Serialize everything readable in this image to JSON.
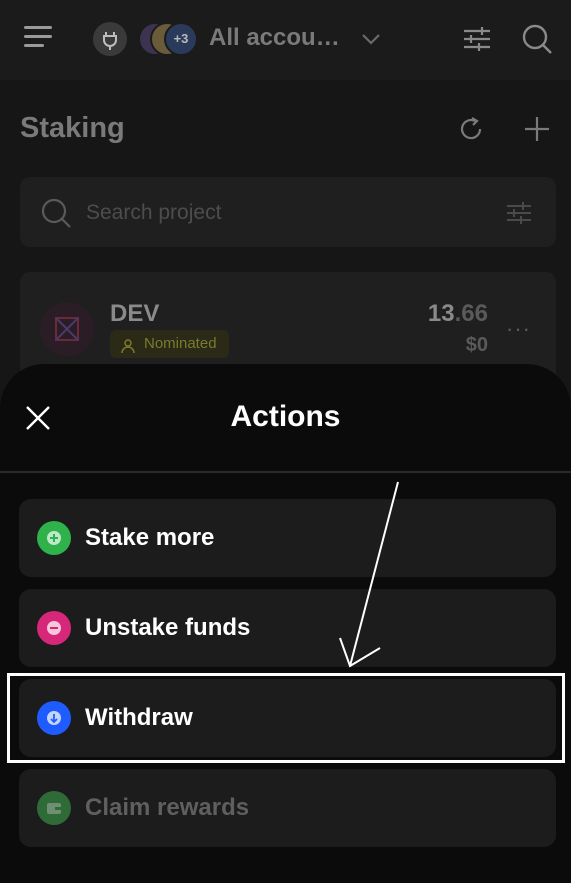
{
  "header": {
    "account_name": "All accou…",
    "account_extra_count": "+3"
  },
  "staking": {
    "title": "Staking",
    "search_placeholder": "Search project",
    "project": {
      "name": "DEV",
      "status": "Nominated",
      "amount_int": "13",
      "amount_dec": ".66",
      "usd": "$0",
      "more": "···"
    }
  },
  "sheet": {
    "title": "Actions",
    "actions": [
      {
        "label": "Stake more",
        "icon": "plus-circle-icon",
        "color": "#2fb14b"
      },
      {
        "label": "Unstake funds",
        "icon": "minus-circle-icon",
        "color": "#d7277a"
      },
      {
        "label": "Withdraw",
        "icon": "arrow-down-circle-icon",
        "color": "#1f5cff"
      },
      {
        "label": "Claim rewards",
        "icon": "wallet-icon",
        "color": "#2f6b36"
      }
    ]
  },
  "colors": {
    "background": "#0b0b0b",
    "card": "#1c1c1c",
    "nominated_badge": "#7a7a30"
  }
}
